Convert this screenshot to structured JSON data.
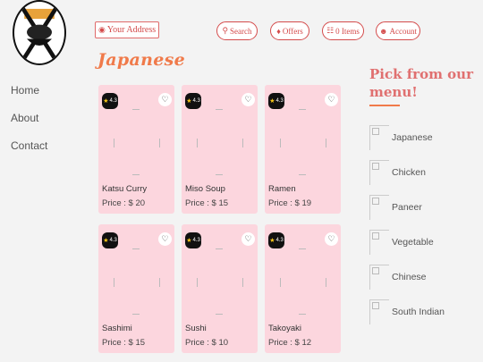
{
  "header": {
    "address_placeholder": "Your Address",
    "search_label": "Search",
    "offers_label": "Offers",
    "cart_label": "0 Items",
    "account_label": "Account"
  },
  "side_nav": [
    "Home",
    "About",
    "Contact"
  ],
  "page_title": "Japanese",
  "cards": [
    {
      "name": "Katsu Curry",
      "price": "Price : $ 20",
      "rating": "4.3"
    },
    {
      "name": "Miso Soup",
      "price": "Price : $ 15",
      "rating": "4.3"
    },
    {
      "name": "Ramen",
      "price": "Price : $ 19",
      "rating": "4.3"
    },
    {
      "name": "Sashimi",
      "price": "Price : $ 15",
      "rating": "4.3"
    },
    {
      "name": "Sushi",
      "price": "Price : $ 10",
      "rating": "4.3"
    },
    {
      "name": "Takoyaki",
      "price": "Price : $ 12",
      "rating": "4.3"
    }
  ],
  "menu": {
    "title": "Pick from our menu!",
    "items": [
      "Japanese",
      "Chicken",
      "Paneer",
      "Vegetable",
      "Chinese",
      "South Indian"
    ]
  },
  "colors": {
    "accent": "#f07a4a",
    "brand_red": "#d44b4b",
    "card_bg": "#fcd6de"
  },
  "icons": {
    "address": "map-marker-icon",
    "search": "search-icon",
    "offers": "tag-icon",
    "cart": "cart-icon",
    "account": "user-circle-icon",
    "rating": "star-icon",
    "favorite": "heart-icon"
  }
}
